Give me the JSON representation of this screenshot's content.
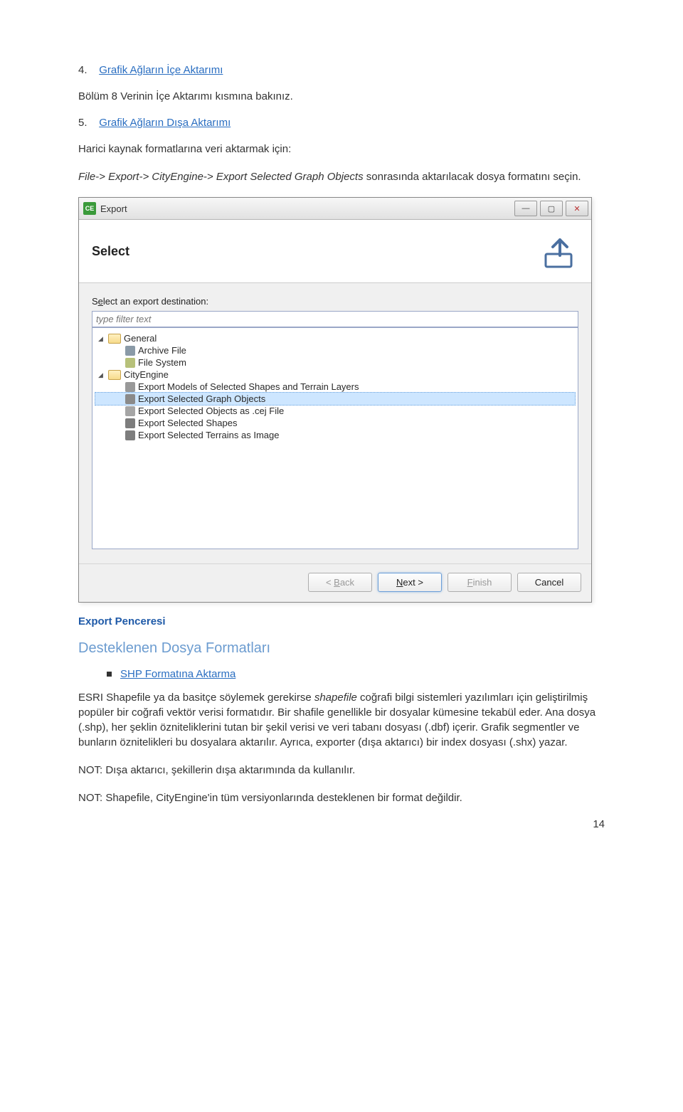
{
  "sections": {
    "s4": {
      "num": "4.",
      "title": "Grafik Ağların İçe Aktarımı"
    },
    "s5": {
      "num": "5.",
      "title": "Grafik Ağların Dışa Aktarımı"
    }
  },
  "para1": "Bölüm 8 Verinin İçe Aktarımı kısmına bakınız.",
  "para2a": "Harici kaynak formatlarına veri aktarmak için:",
  "para2b_pre": "File-> Export-> CityEngine-> Export Selected Graph Objects",
  "para2b_post": " sonrasında aktarılacak dosya formatını seçin.",
  "window": {
    "title": "Export",
    "select_banner": "Select",
    "dest_label_pre": "S",
    "dest_label_u": "e",
    "dest_label_post": "lect an export destination:",
    "filter_placeholder": "type filter text",
    "tree": {
      "general": "General",
      "archive": "Archive File",
      "fs": "File System",
      "cityengine": "CityEngine",
      "opt1": "Export Models of Selected Shapes and Terrain Layers",
      "opt2": "Export Selected Graph Objects",
      "opt3": "Export Selected Objects as .cej File",
      "opt4": "Export Selected Shapes",
      "opt5": "Export Selected Terrains as Image"
    },
    "buttons": {
      "back": "< Back",
      "next": "Next >",
      "finish": "Finish",
      "cancel": "Cancel"
    }
  },
  "caption": "Export Penceresi",
  "h2": "Desteklenen Dosya Formatları",
  "bullet1": "SHP Formatına Aktarma",
  "para3a": "ESRI Shapefile ya da basitçe söylemek gerekirse ",
  "para3a_it": "shapefile",
  "para3a2": " coğrafi bilgi sistemleri yazılımları için geliştirilmiş popüler bir coğrafi vektör verisi formatıdır. Bir shafile genellikle bir dosyalar kümesine tekabül eder. Ana dosya (.shp), her şeklin özniteliklerini tutan bir şekil verisi ve veri tabanı dosyası (.dbf) içerir. Grafik segmentler ve bunların öznitelikleri bu dosyalara aktarılır. Ayrıca, exporter (dışa aktarıcı) bir index dosyası (.shx) yazar.",
  "note1": "NOT: Dışa aktarıcı, şekillerin dışa aktarımında da kullanılır.",
  "note2": "NOT: Shapefile, CityEngine'in tüm versiyonlarında desteklenen bir format değildir.",
  "page_num": "14"
}
